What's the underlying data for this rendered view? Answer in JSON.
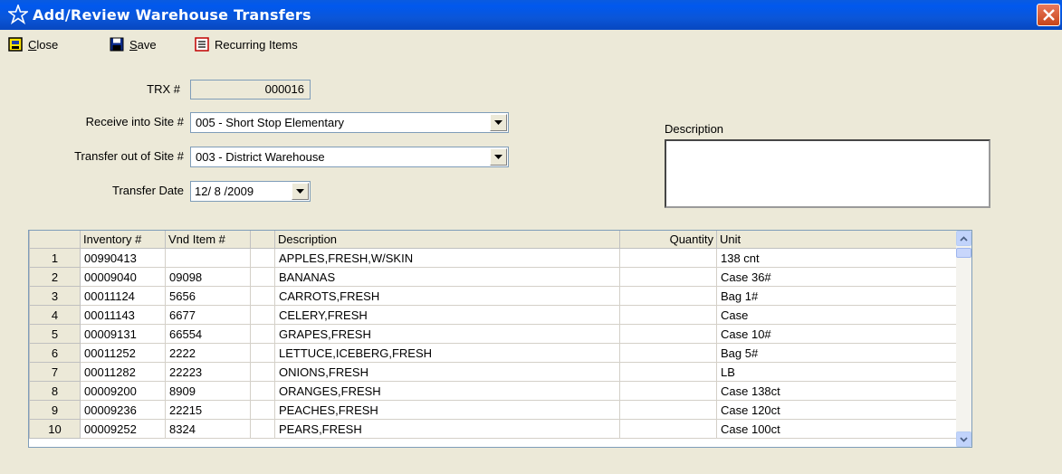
{
  "window": {
    "title": "Add/Review Warehouse Transfers"
  },
  "toolbar": {
    "close_label": "Close",
    "save_label": "Save",
    "recurring_label": "Recurring Items"
  },
  "form": {
    "trx_label": "TRX #",
    "trx_value": "000016",
    "receive_label": "Receive into Site #",
    "receive_value": "005 - Short Stop Elementary",
    "transfer_out_label": "Transfer out of Site #",
    "transfer_out_value": "003 - District Warehouse",
    "transfer_date_label": "Transfer Date",
    "transfer_date_value": "12/ 8 /2009",
    "description_label": "Description",
    "description_value": ""
  },
  "grid": {
    "columns": [
      "Inventory #",
      "Vnd Item #",
      "",
      "Description",
      "Quantity",
      "Unit"
    ],
    "rows": [
      {
        "num": "1",
        "inventory": "00990413",
        "vnd_item": "",
        "description": "APPLES,FRESH,W/SKIN",
        "quantity": "",
        "unit": "138 cnt"
      },
      {
        "num": "2",
        "inventory": "00009040",
        "vnd_item": "09098",
        "description": "BANANAS",
        "quantity": "",
        "unit": "Case 36#"
      },
      {
        "num": "3",
        "inventory": "00011124",
        "vnd_item": "5656",
        "description": "CARROTS,FRESH",
        "quantity": "",
        "unit": "Bag 1#"
      },
      {
        "num": "4",
        "inventory": "00011143",
        "vnd_item": "6677",
        "description": "CELERY,FRESH",
        "quantity": "",
        "unit": "Case"
      },
      {
        "num": "5",
        "inventory": "00009131",
        "vnd_item": "66554",
        "description": "GRAPES,FRESH",
        "quantity": "",
        "unit": "Case 10#"
      },
      {
        "num": "6",
        "inventory": "00011252",
        "vnd_item": "2222",
        "description": "LETTUCE,ICEBERG,FRESH",
        "quantity": "",
        "unit": "Bag 5#"
      },
      {
        "num": "7",
        "inventory": "00011282",
        "vnd_item": "22223",
        "description": "ONIONS,FRESH",
        "quantity": "",
        "unit": "LB"
      },
      {
        "num": "8",
        "inventory": "00009200",
        "vnd_item": "8909",
        "description": "ORANGES,FRESH",
        "quantity": "",
        "unit": "Case 138ct"
      },
      {
        "num": "9",
        "inventory": "00009236",
        "vnd_item": "22215",
        "description": "PEACHES,FRESH",
        "quantity": "",
        "unit": "Case 120ct"
      },
      {
        "num": "10",
        "inventory": "00009252",
        "vnd_item": "8324",
        "description": "PEARS,FRESH",
        "quantity": "",
        "unit": "Case 100ct"
      }
    ]
  },
  "icons": {
    "title": "star-app-icon",
    "close_window": "close-x-icon",
    "close": "close-door-icon",
    "save": "floppy-disk-icon",
    "recurring": "list-icon",
    "dropdown": "chevron-down-icon",
    "scroll_up": "scroll-up-arrow-icon",
    "scroll_down": "scroll-down-arrow-icon"
  },
  "colors": {
    "titlebar": "#0058ee",
    "close_button": "#d9552c",
    "window_bg": "#ece9d8"
  }
}
